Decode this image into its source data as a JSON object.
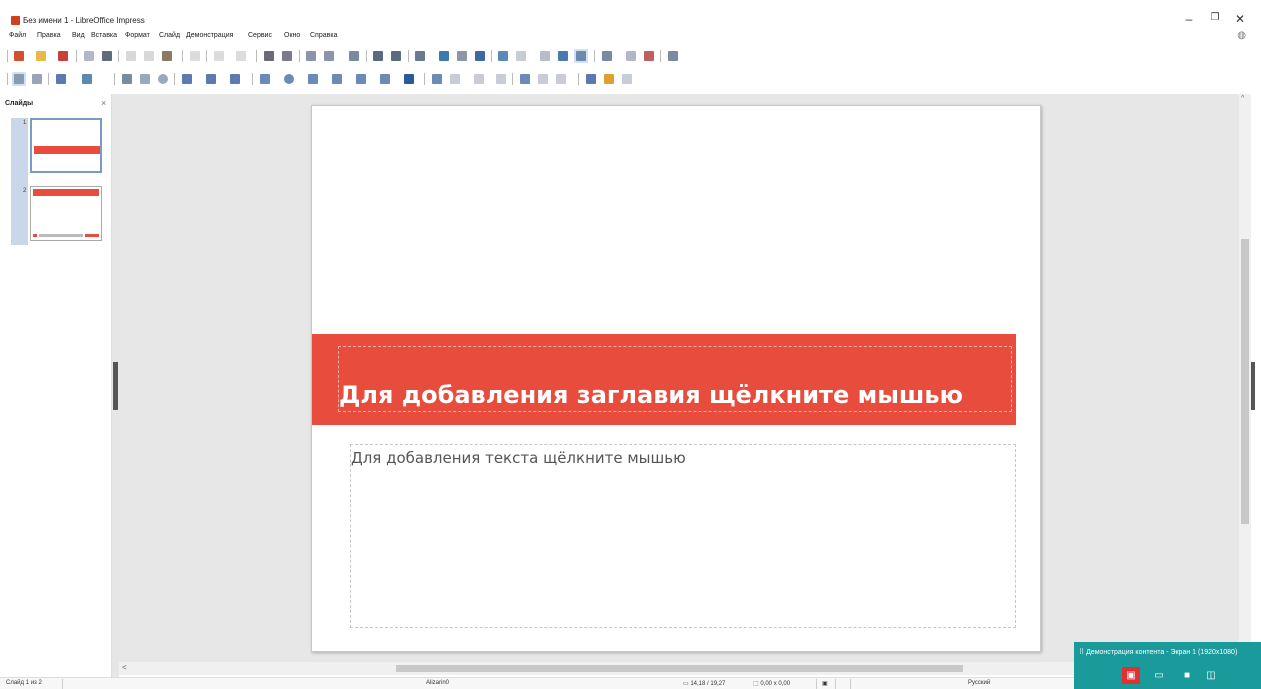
{
  "window": {
    "title": "Без имени 1 - LibreOffice Impress",
    "controls": {
      "minimize": "–",
      "maximize": "❐",
      "close": "✕"
    }
  },
  "menu": [
    "Файл",
    "Правка",
    "Вид",
    "Вставка",
    "Формат",
    "Слайд",
    "Демонстрация",
    "Сервис",
    "Окно",
    "Справка"
  ],
  "slides_panel": {
    "title": "Слайды",
    "close": "×",
    "thumbnails": [
      {
        "number": "1",
        "selected": true
      },
      {
        "number": "2",
        "selected": false
      }
    ]
  },
  "slide": {
    "title_placeholder": "Для добавления заглавия щёлкните мышью",
    "body_placeholder": "Для добавления текста щёлкните мышью",
    "accent_color": "#e74c3c"
  },
  "scrollbars": {
    "up_arrow": "^",
    "left_arrow": "<"
  },
  "status": {
    "slide_info": "Слайд 1 из 2",
    "master_name": "Alizarin0",
    "position": "14,18 / 19,27",
    "size": "0,00 x 0,00",
    "language": "Русский"
  },
  "teams": {
    "label": "⠿ Демонстрация контента - Экран 1 (1920x1080)",
    "color": "#1a9a9a"
  }
}
